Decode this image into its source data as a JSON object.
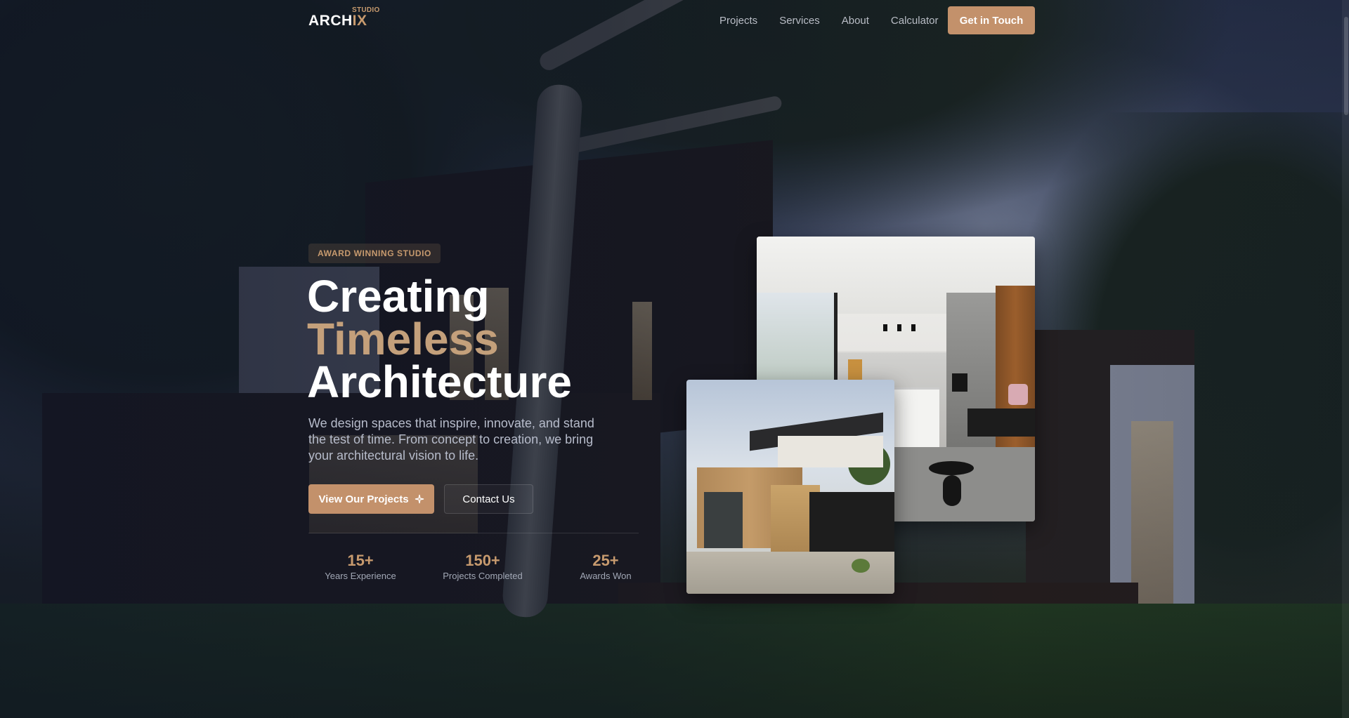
{
  "brand": {
    "logo_main": "ARCH",
    "logo_accent": "IX",
    "logo_sub": "STUDIO"
  },
  "nav": {
    "links": [
      "Projects",
      "Services",
      "About",
      "Calculator"
    ],
    "cta_label": "Get in Touch"
  },
  "hero": {
    "badge": "AWARD WINNING STUDIO",
    "headline_line1": "Creating",
    "headline_line2": "Timeless",
    "headline_line3": "Architecture",
    "description": "We design spaces that inspire, innovate, and stand the test of time. From concept to creation, we bring your architectural vision to life.",
    "primary_button": "View Our Projects",
    "secondary_button": "Contact Us"
  },
  "stats": [
    {
      "value": "15+",
      "label": "Years Experience"
    },
    {
      "value": "150+",
      "label": "Projects Completed"
    },
    {
      "value": "25+",
      "label": "Awards Won"
    }
  ],
  "colors": {
    "accent": "#c3916b",
    "headline_accent": "#c4a07b",
    "overlay": "#0e1426"
  },
  "icons": {
    "primary_button_icon": "sparkle-icon"
  },
  "images": {
    "interior_photo": "interior-living-kitchen-photo",
    "exterior_photo": "modern-house-exterior-photo"
  }
}
